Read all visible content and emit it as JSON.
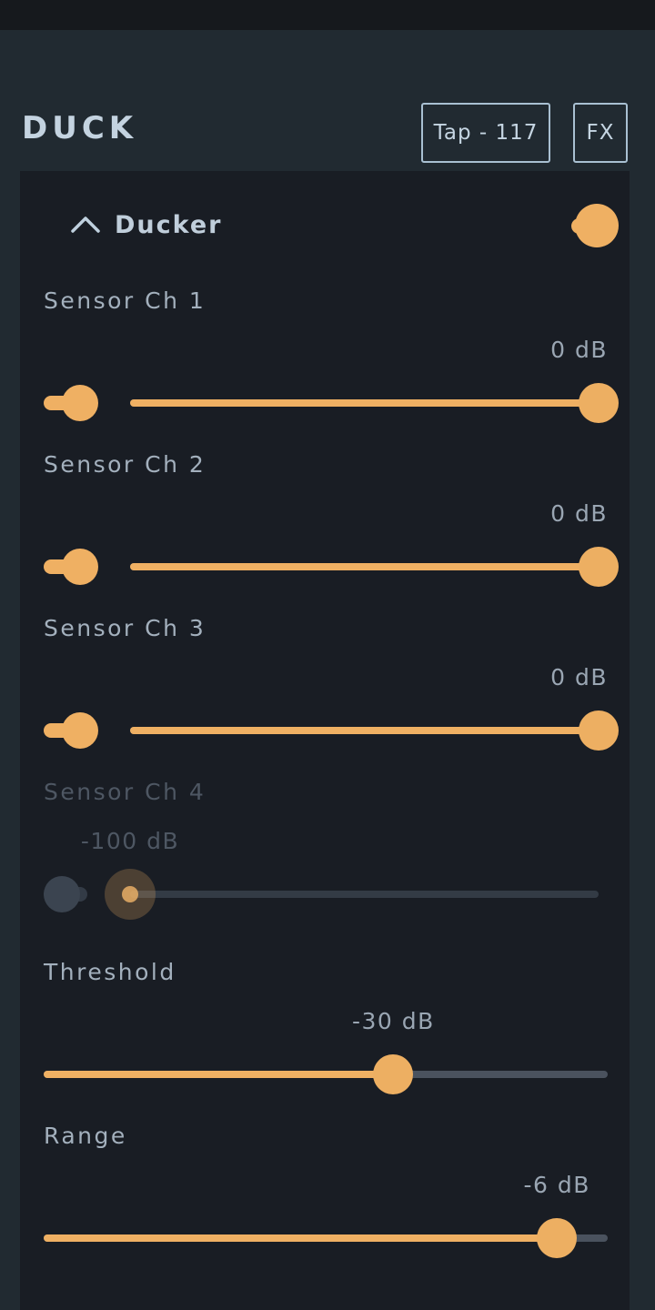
{
  "header": {
    "title": "DUCK",
    "tap_button": "Tap - 117",
    "fx_button": "FX"
  },
  "section": {
    "title": "Ducker",
    "collapse_icon": "chevron-up-icon",
    "enabled": true
  },
  "colors": {
    "accent": "#efb063",
    "track_inactive": "#4a525e",
    "page_background": "#212a31",
    "card_background": "#191d24",
    "status_bar": "#16191d",
    "label_text": "#a3b0bd",
    "label_text_disabled": "#4e5763",
    "button_border": "#a9c0d2"
  },
  "parameters": [
    {
      "label": "Sensor Ch 1",
      "value": "0 dB",
      "has_toggle": true,
      "toggle_on": true,
      "enabled": true,
      "fill_percent": 100
    },
    {
      "label": "Sensor Ch 2",
      "value": "0 dB",
      "has_toggle": true,
      "toggle_on": true,
      "enabled": true,
      "fill_percent": 100
    },
    {
      "label": "Sensor Ch 3",
      "value": "0 dB",
      "has_toggle": true,
      "toggle_on": true,
      "enabled": true,
      "fill_percent": 100
    },
    {
      "label": "Sensor Ch 4",
      "value": "-100 dB",
      "has_toggle": true,
      "toggle_on": false,
      "enabled": false,
      "fill_percent": 0
    },
    {
      "label": "Threshold",
      "value": "-30 dB",
      "has_toggle": false,
      "toggle_on": null,
      "enabled": true,
      "fill_percent": 62
    },
    {
      "label": "Range",
      "value": "-6 dB",
      "has_toggle": false,
      "toggle_on": null,
      "enabled": true,
      "fill_percent": 91
    }
  ]
}
